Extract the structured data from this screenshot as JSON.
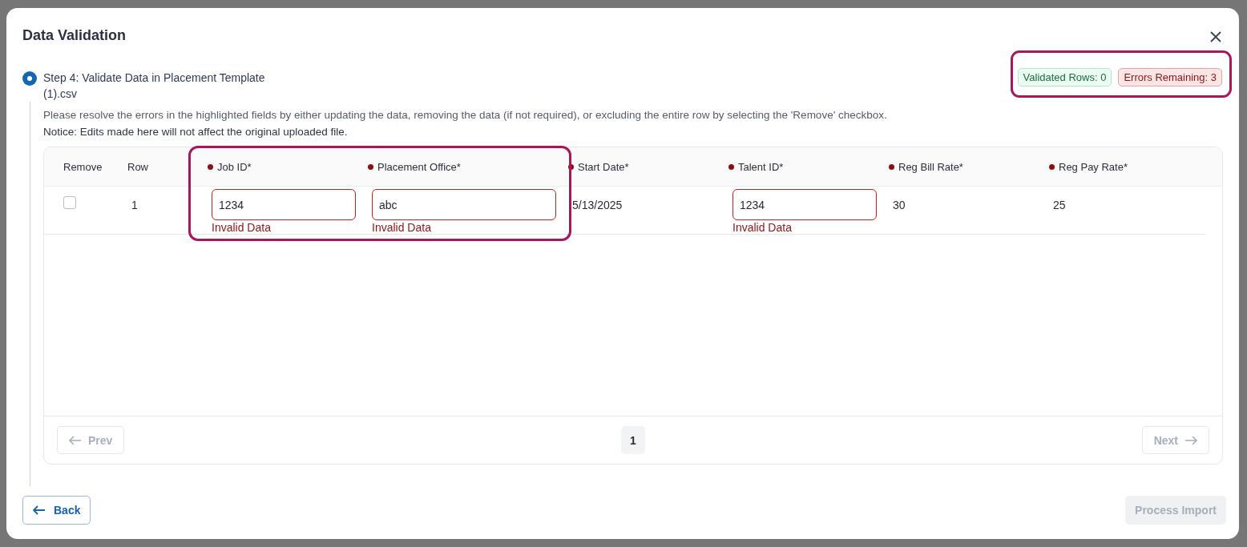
{
  "dialog": {
    "title": "Data Validation"
  },
  "step": {
    "label": "Step 4: Validate Data in Placement Template (1).csv"
  },
  "badges": [
    {
      "kind": "success",
      "text": "Validated Rows: 0"
    },
    {
      "kind": "error",
      "text": "Errors Remaining: 3"
    }
  ],
  "instructions": "Please resolve the errors in the highlighted fields by either updating the data, removing the data (if not required), or excluding the entire row by selecting the 'Remove' checkbox.",
  "notice": "Notice: Edits made here will not affect the original uploaded file.",
  "table": {
    "columns": [
      {
        "label": "Remove",
        "required": false
      },
      {
        "label": "Row",
        "required": false
      },
      {
        "label": "Job ID*",
        "required": true
      },
      {
        "label": "Placement Office*",
        "required": true
      },
      {
        "label": "Start Date*",
        "required": true
      },
      {
        "label": "Talent ID*",
        "required": true
      },
      {
        "label": "Reg Bill Rate*",
        "required": true
      },
      {
        "label": "Reg Pay Rate*",
        "required": true
      }
    ],
    "rows": [
      {
        "cells": [
          {
            "kind": "checkbox",
            "checked": false
          },
          {
            "kind": "text",
            "value": "1"
          },
          {
            "kind": "input",
            "value": "1234",
            "error": "Invalid Data"
          },
          {
            "kind": "input",
            "value": "abc",
            "error": "Invalid Data"
          },
          {
            "kind": "text",
            "value": "5/13/2025"
          },
          {
            "kind": "input",
            "value": "1234",
            "error": "Invalid Data"
          },
          {
            "kind": "text",
            "value": "30"
          },
          {
            "kind": "text",
            "value": "25"
          }
        ]
      }
    ]
  },
  "pagination": {
    "prev": {
      "label": "Prev",
      "disabled": true
    },
    "pages": [
      {
        "label": "1",
        "selected": true
      }
    ],
    "next": {
      "label": "Next",
      "disabled": true
    }
  },
  "footer": {
    "back": {
      "label": "Back",
      "disabled": false
    },
    "process": {
      "label": "Process Import",
      "disabled": true
    }
  }
}
